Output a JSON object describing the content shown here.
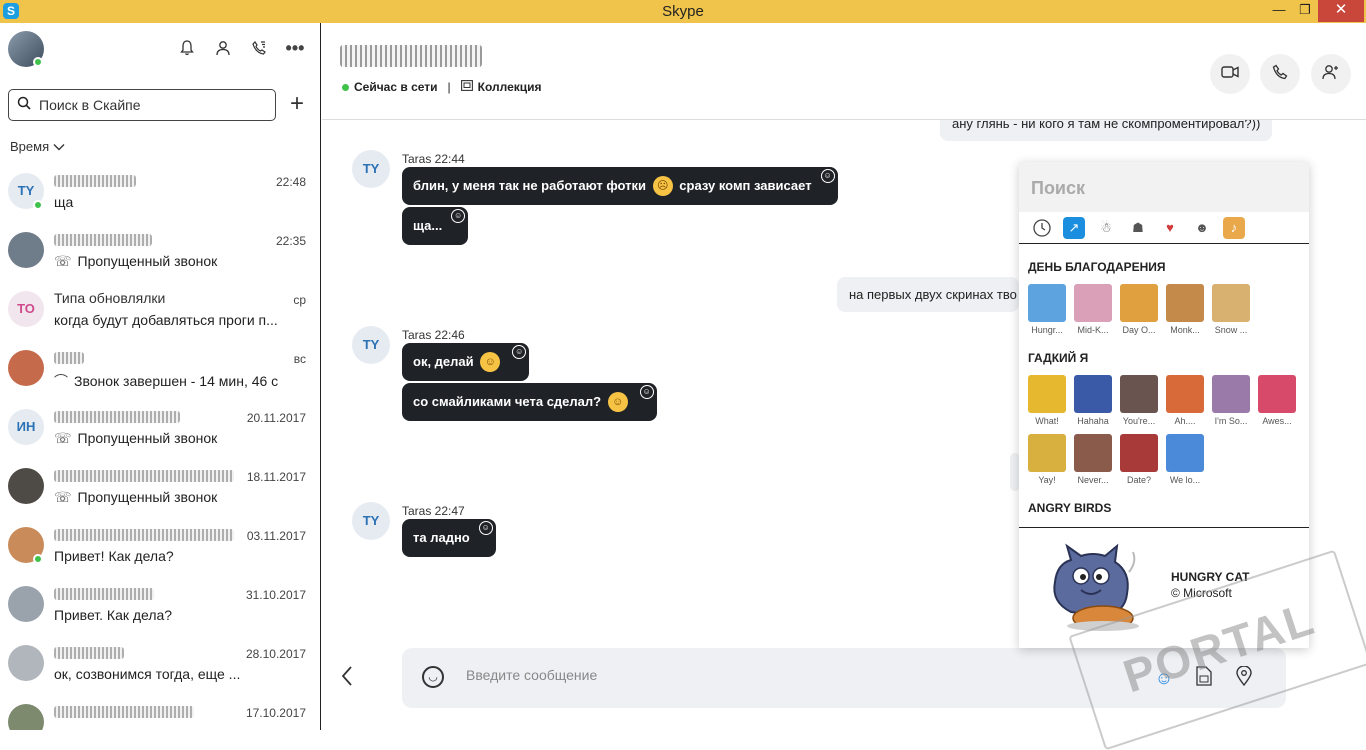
{
  "window": {
    "title": "Skype",
    "minimize": "—",
    "maximize": "❐",
    "close": "✕"
  },
  "sidebar": {
    "search_placeholder": "Поиск в Скайпе",
    "sort_label": "Время",
    "contacts": [
      {
        "initials": "TY",
        "name": "",
        "time": "22:48",
        "message": "ща",
        "online": true,
        "bg": "#e6ebf1",
        "fg": "#2a72b5"
      },
      {
        "initials": "",
        "name": "",
        "time": "22:35",
        "message": "Пропущенный звонок",
        "icon": "missed-call",
        "bg": "#6f7c89"
      },
      {
        "initials": "TO",
        "name": "Типа обновлялки",
        "time": "ср",
        "message": "когда будут добавляться проги п...",
        "bg": "#f2e6ee",
        "fg": "#d04a8b"
      },
      {
        "initials": "",
        "name": "",
        "time": "вс",
        "message": "Звонок завершен - 14 мин, 46 с",
        "icon": "call-ended",
        "bg": "#c56a4a"
      },
      {
        "initials": "ИН",
        "name": "",
        "time": "20.11.2017",
        "message": "Пропущенный звонок",
        "icon": "missed-call",
        "bg": "#e6ebf1",
        "fg": "#2a72b5"
      },
      {
        "initials": "",
        "name": "",
        "time": "18.11.2017",
        "message": "Пропущенный звонок",
        "icon": "missed-call",
        "bg": "#4e4a45"
      },
      {
        "initials": "",
        "name": "",
        "time": "03.11.2017",
        "message": "Привет! Как дела?",
        "online": true,
        "bg": "#c98b5a"
      },
      {
        "initials": "",
        "name": "",
        "time": "31.10.2017",
        "message": "Привет. Как дела?",
        "bg": "#9aa3ab"
      },
      {
        "initials": "",
        "name": "",
        "time": "28.10.2017",
        "message": "ок, созвонимся тогда, еще ...",
        "bg": "#b0b6bb"
      },
      {
        "initials": "",
        "name": "",
        "time": "17.10.2017",
        "message": "",
        "bg": "#7d8a6e"
      }
    ]
  },
  "chat": {
    "status": "Сейчас в сети",
    "collection": "Коллекция",
    "outgoing": [
      "ану глянь - ни кого я там не скомпроментировал?))",
      "на первых двух скринах тво"
    ],
    "groups": [
      {
        "initials": "TY",
        "sender": "Taras 22:44",
        "messages": [
          {
            "before": "блин, у меня так не работают фотки",
            "emoji": "☹",
            "after": "сразу комп зависает"
          },
          {
            "before": "ща...",
            "emoji": "",
            "after": ""
          }
        ]
      },
      {
        "initials": "TY",
        "sender": "Taras 22:46",
        "messages": [
          {
            "before": "ок, делай",
            "emoji": "☺",
            "after": ""
          },
          {
            "before": "со смайликами чета сделал?",
            "emoji": "☺",
            "after": ""
          }
        ]
      },
      {
        "initials": "TY",
        "sender": "Taras 22:47",
        "messages": [
          {
            "before": "та ладно",
            "emoji": "",
            "after": ""
          }
        ]
      }
    ],
    "composer_placeholder": "Введите сообщение"
  },
  "sticker_picker": {
    "search": "Поиск",
    "sections": [
      {
        "title": "ДЕНЬ БЛАГОДАРЕНИЯ",
        "items": [
          {
            "label": "Hungr...",
            "color": "#5da3e0"
          },
          {
            "label": "Mid-K...",
            "color": "#d9a0b8"
          },
          {
            "label": "Day O...",
            "color": "#e0a040"
          },
          {
            "label": "Monk...",
            "color": "#c48a4a"
          },
          {
            "label": "Snow ...",
            "color": "#d8b070"
          }
        ]
      },
      {
        "title": "ГАДКИЙ Я",
        "items": [
          {
            "label": "What!",
            "color": "#e6b830"
          },
          {
            "label": "Hahaha",
            "color": "#3a5aa8"
          },
          {
            "label": "You're...",
            "color": "#6a5450"
          },
          {
            "label": "Ah....",
            "color": "#d86a3a"
          },
          {
            "label": "I'm So...",
            "color": "#9a7aa8"
          },
          {
            "label": "Awes...",
            "color": "#d84a6a"
          },
          {
            "label": "Yay!",
            "color": "#d8b040"
          },
          {
            "label": "Never...",
            "color": "#8a5a4a"
          },
          {
            "label": "Date?",
            "color": "#a83a3a"
          },
          {
            "label": "We lo...",
            "color": "#4a8ad8"
          }
        ]
      },
      {
        "title": "ANGRY BIRDS",
        "items": []
      }
    ],
    "preview_title": "HUNGRY CAT",
    "preview_copyright": "© Microsoft"
  },
  "watermark": "PORTAL"
}
